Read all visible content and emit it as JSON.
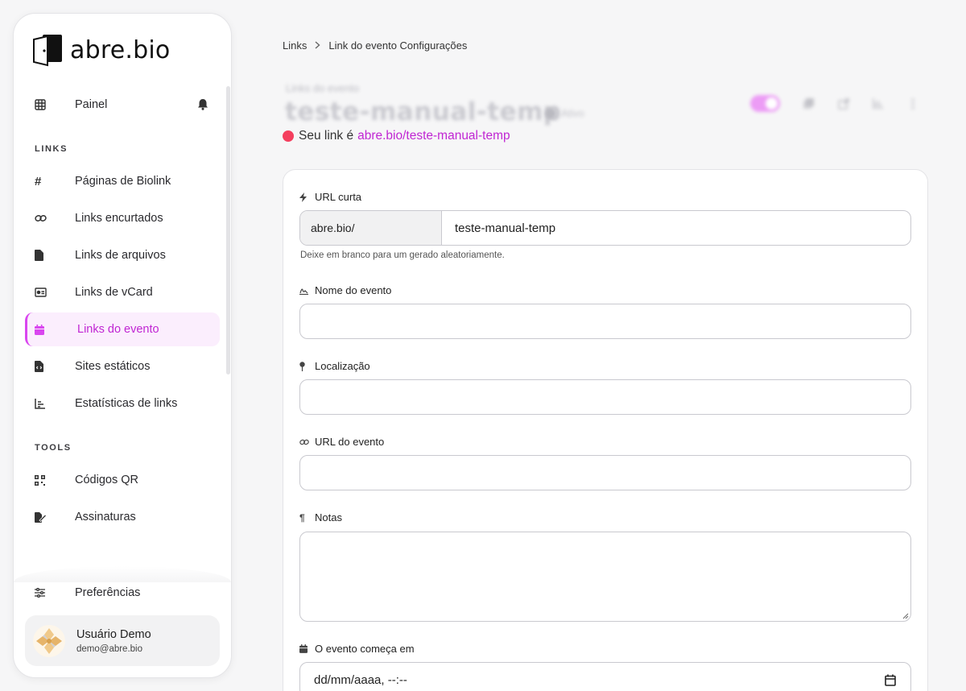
{
  "brand": {
    "name": "abre.bio",
    "accent": "#d946ef"
  },
  "sidebar": {
    "dashboard": {
      "label": "Painel",
      "icon": "grid-icon"
    },
    "sections": [
      {
        "label": "LINKS"
      },
      {
        "label": "TOOLS"
      }
    ],
    "links_items": [
      {
        "label": "Páginas de Biolink",
        "icon": "hash-icon"
      },
      {
        "label": "Links encurtados",
        "icon": "link-icon"
      },
      {
        "label": "Links de arquivos",
        "icon": "file-icon"
      },
      {
        "label": "Links de vCard",
        "icon": "id-card-icon"
      },
      {
        "label": "Links do evento",
        "icon": "calendar-icon",
        "active": true
      },
      {
        "label": "Sites estáticos",
        "icon": "file-code-icon"
      },
      {
        "label": "Estatísticas de links",
        "icon": "chart-icon"
      }
    ],
    "tools_items": [
      {
        "label": "Códigos QR",
        "icon": "qr-icon"
      },
      {
        "label": "Assinaturas",
        "icon": "signature-icon"
      }
    ],
    "preferences": {
      "label": "Preferências",
      "icon": "sliders-icon"
    },
    "user": {
      "name": "Usuário Demo",
      "email": "demo@abre.bio"
    }
  },
  "breadcrumb": {
    "root": "Links",
    "current": "Link do evento Configurações"
  },
  "header": {
    "subtitle": "Links do evento",
    "title": "teste-manual-temp",
    "status": "Ativo",
    "link_prefix": "Seu link é",
    "link_url": "abre.bio/teste-manual-temp"
  },
  "form": {
    "short_url": {
      "label": "URL curta",
      "prefix": "abre.bio/",
      "value": "teste-manual-temp",
      "help": "Deixe em branco para um gerado aleatoriamente."
    },
    "event_name": {
      "label": "Nome do evento",
      "value": ""
    },
    "location": {
      "label": "Localização",
      "value": ""
    },
    "event_url": {
      "label": "URL do evento",
      "value": ""
    },
    "notes": {
      "label": "Notas",
      "value": ""
    },
    "starts_at": {
      "label": "O evento começa em",
      "value": "dd/mm/aaaa, --:--"
    }
  }
}
